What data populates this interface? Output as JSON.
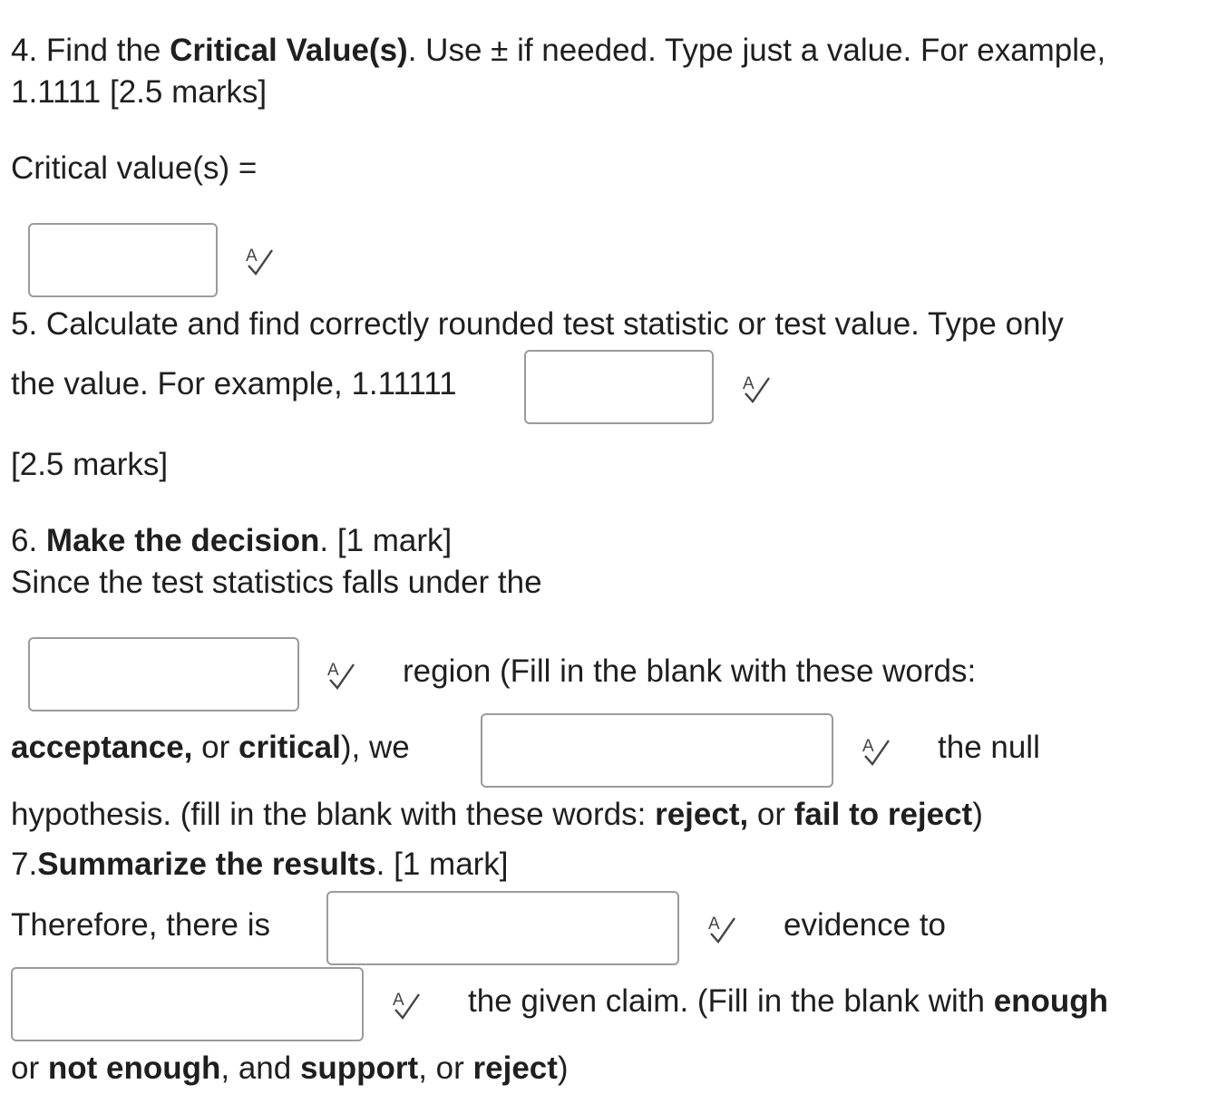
{
  "q4": {
    "prefix": "4. Find the ",
    "bold": "Critical Value(s)",
    "suffix": ". Use ± if needed. Type just a value. For example,",
    "line2": "1.1111 [2.5 marks]",
    "label": "Critical value(s) =",
    "input_value": ""
  },
  "q5": {
    "line1": "5. Calculate and find correctly rounded test statistic or test value. Type only",
    "line2": "the value. For example, 1.11111",
    "marks": "[2.5 marks]",
    "input_value": ""
  },
  "q6": {
    "num": "6. ",
    "bold": "Make the decision",
    "suffix": ". [1 mark]",
    "line2": "Since the test statistics falls under the",
    "region_text": "region (Fill in the blank with these words:",
    "acceptance": "acceptance,",
    "or1": " or ",
    "critical": "critical",
    "we": "), we",
    "the_null": "the null",
    "hyp_prefix": "hypothesis. (fill in the blank with these words: ",
    "reject": "reject,",
    "or2": " or ",
    "fail": "fail to reject",
    "close": ")",
    "region_input": "",
    "decision_input": ""
  },
  "q7": {
    "num": "7.",
    "bold": "Summarize the results",
    "suffix": ". [1 mark]",
    "therefore": "Therefore, there is",
    "evidence_to": "evidence to",
    "given_claim": "the given claim. (Fill in the blank with ",
    "enough": "enough",
    "or_pre": "or ",
    "not_enough": "not enough",
    "and": ", and ",
    "support": "support",
    "or3": ", or ",
    "reject": "reject",
    "close": ")",
    "evidence_input": "",
    "claim_input": ""
  },
  "icons": {
    "spellcheck": "spellcheck-icon"
  }
}
